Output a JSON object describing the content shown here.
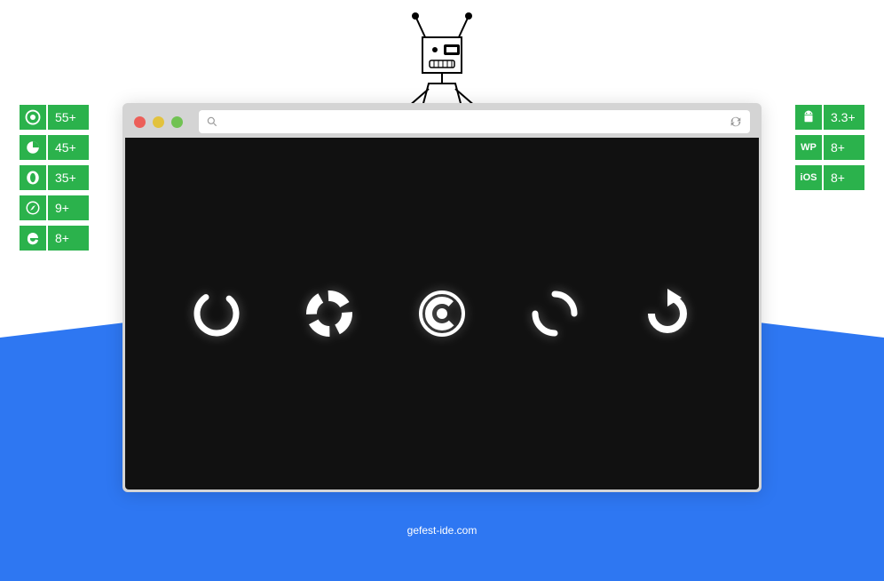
{
  "colors": {
    "blue": "#2e77f2",
    "green": "#2bb24c",
    "traffic_red": "#ec5f59",
    "traffic_yellow": "#e2c23e",
    "traffic_green": "#71c253"
  },
  "badges_left": [
    {
      "icon": "chrome-icon",
      "version": "55+"
    },
    {
      "icon": "firefox-icon",
      "version": "45+"
    },
    {
      "icon": "opera-icon",
      "version": "35+"
    },
    {
      "icon": "safari-icon",
      "version": "9+"
    },
    {
      "icon": "ie-icon",
      "version": "8+"
    }
  ],
  "badges_right": [
    {
      "icon": "android-icon",
      "version": "3.3+"
    },
    {
      "icon": "wp-icon",
      "label": "WP",
      "version": "8+"
    },
    {
      "icon": "ios-icon",
      "label": "iOS",
      "version": "8+"
    }
  ],
  "address_bar": {
    "placeholder": ""
  },
  "spinners": [
    "spinner-ring",
    "spinner-segmented",
    "spinner-orbit",
    "spinner-dual-arc",
    "spinner-arrow-refresh"
  ],
  "footer_url": "gefest-ide.com"
}
